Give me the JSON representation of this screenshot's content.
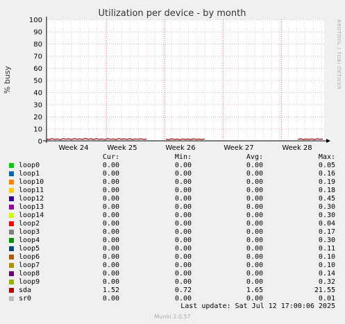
{
  "chart_data": {
    "type": "line",
    "title": "Utilization per device - by month",
    "ylabel": "% busy",
    "ylim": [
      0,
      100
    ],
    "yticks": [
      "0",
      "10",
      "20",
      "30",
      "40",
      "50",
      "60",
      "70",
      "80",
      "90",
      "100"
    ],
    "xticks": [
      "Week 24",
      "Week 25",
      "Week 26",
      "Week 27",
      "Week 28"
    ],
    "grid": true,
    "side_text": "RRDTOOL / TOBI OETIKER",
    "series": [
      {
        "name": "sda",
        "color": "#990000",
        "segments": [
          [
            [
              0,
              1.5
            ],
            [
              4,
              1.1
            ],
            [
              8,
              1.9
            ],
            [
              12,
              1.2
            ],
            [
              16,
              1.6
            ],
            [
              20,
              1.0
            ],
            [
              24,
              1.8
            ],
            [
              28,
              1.3
            ],
            [
              32,
              1.7
            ],
            [
              36,
              1.1
            ],
            [
              40,
              1.9
            ],
            [
              44,
              1.4
            ],
            [
              48,
              1.6
            ],
            [
              52,
              1.2
            ],
            [
              56,
              2.0
            ],
            [
              60,
              1.3
            ],
            [
              64,
              1.7
            ],
            [
              68,
              1.1
            ],
            [
              72,
              1.8
            ],
            [
              76,
              1.2
            ],
            [
              80,
              1.6
            ],
            [
              84,
              1.0
            ],
            [
              88,
              1.8
            ],
            [
              92,
              1.3
            ],
            [
              96,
              1.6
            ],
            [
              100,
              1.1
            ],
            [
              104,
              1.9
            ],
            [
              108,
              1.3
            ],
            [
              112,
              1.7
            ],
            [
              116,
              1.2
            ],
            [
              120,
              1.8
            ],
            [
              124,
              1.1
            ],
            [
              128,
              1.6
            ],
            [
              132,
              1.3
            ],
            [
              136,
              1.7
            ],
            [
              140,
              1.2
            ],
            [
              144,
              1.5
            ]
          ],
          [
            [
              172,
              1.4
            ],
            [
              176,
              1.0
            ],
            [
              180,
              1.7
            ],
            [
              184,
              1.2
            ],
            [
              188,
              1.5
            ],
            [
              192,
              1.0
            ],
            [
              196,
              1.6
            ],
            [
              200,
              1.2
            ],
            [
              204,
              1.5
            ],
            [
              208,
              1.1
            ],
            [
              212,
              1.7
            ],
            [
              216,
              1.2
            ],
            [
              220,
              1.5
            ],
            [
              224,
              1.1
            ],
            [
              228,
              1.6
            ]
          ],
          [
            [
              362,
              1.2
            ],
            [
              366,
              1.7
            ],
            [
              370,
              1.1
            ],
            [
              374,
              1.5
            ],
            [
              378,
              1.2
            ],
            [
              382,
              1.6
            ],
            [
              386,
              1.1
            ],
            [
              390,
              1.7
            ],
            [
              394,
              1.3
            ],
            [
              398,
              1.5
            ]
          ]
        ]
      }
    ]
  },
  "legend": {
    "headers": [
      "Cur:",
      "Min:",
      "Avg:",
      "Max:"
    ],
    "rows": [
      {
        "name": "loop0",
        "color": "#00cc00",
        "cur": "0.00",
        "min": "0.00",
        "avg": "0.00",
        "max": "0.05"
      },
      {
        "name": "loop1",
        "color": "#0066b3",
        "cur": "0.00",
        "min": "0.00",
        "avg": "0.00",
        "max": "0.16"
      },
      {
        "name": "loop10",
        "color": "#ff8000",
        "cur": "0.00",
        "min": "0.00",
        "avg": "0.00",
        "max": "0.19"
      },
      {
        "name": "loop11",
        "color": "#ffcc00",
        "cur": "0.00",
        "min": "0.00",
        "avg": "0.00",
        "max": "0.18"
      },
      {
        "name": "loop12",
        "color": "#330099",
        "cur": "0.00",
        "min": "0.00",
        "avg": "0.00",
        "max": "0.45"
      },
      {
        "name": "loop13",
        "color": "#990099",
        "cur": "0.00",
        "min": "0.00",
        "avg": "0.00",
        "max": "0.30"
      },
      {
        "name": "loop14",
        "color": "#ccff00",
        "cur": "0.00",
        "min": "0.00",
        "avg": "0.00",
        "max": "0.30"
      },
      {
        "name": "loop2",
        "color": "#ff0000",
        "cur": "0.00",
        "min": "0.00",
        "avg": "0.00",
        "max": "0.04"
      },
      {
        "name": "loop3",
        "color": "#808080",
        "cur": "0.00",
        "min": "0.00",
        "avg": "0.00",
        "max": "0.17"
      },
      {
        "name": "loop4",
        "color": "#008f00",
        "cur": "0.00",
        "min": "0.00",
        "avg": "0.00",
        "max": "0.30"
      },
      {
        "name": "loop5",
        "color": "#00487d",
        "cur": "0.00",
        "min": "0.00",
        "avg": "0.00",
        "max": "0.11"
      },
      {
        "name": "loop6",
        "color": "#b35a00",
        "cur": "0.00",
        "min": "0.00",
        "avg": "0.00",
        "max": "0.10"
      },
      {
        "name": "loop7",
        "color": "#b38f00",
        "cur": "0.00",
        "min": "0.00",
        "avg": "0.00",
        "max": "0.10"
      },
      {
        "name": "loop8",
        "color": "#6b006b",
        "cur": "0.00",
        "min": "0.00",
        "avg": "0.00",
        "max": "0.14"
      },
      {
        "name": "loop9",
        "color": "#8fb300",
        "cur": "0.00",
        "min": "0.00",
        "avg": "0.00",
        "max": "0.32"
      },
      {
        "name": "sda",
        "color": "#b30000",
        "cur": "1.52",
        "min": "0.72",
        "avg": "1.65",
        "max": "21.55"
      },
      {
        "name": "sr0",
        "color": "#bebebe",
        "cur": "0.00",
        "min": "0.00",
        "avg": "0.00",
        "max": "0.01"
      }
    ]
  },
  "footer": {
    "last_update": "Last update: Sat Jul 12 17:00:06 2025",
    "munin": "Munin 2.0.57"
  },
  "colors": {
    "background": "#f0f0f0",
    "plot_background": "#ffffff",
    "grid_minor": "#e0a0a0",
    "grid_major": "#e0c8c8",
    "axis": "#000000"
  }
}
